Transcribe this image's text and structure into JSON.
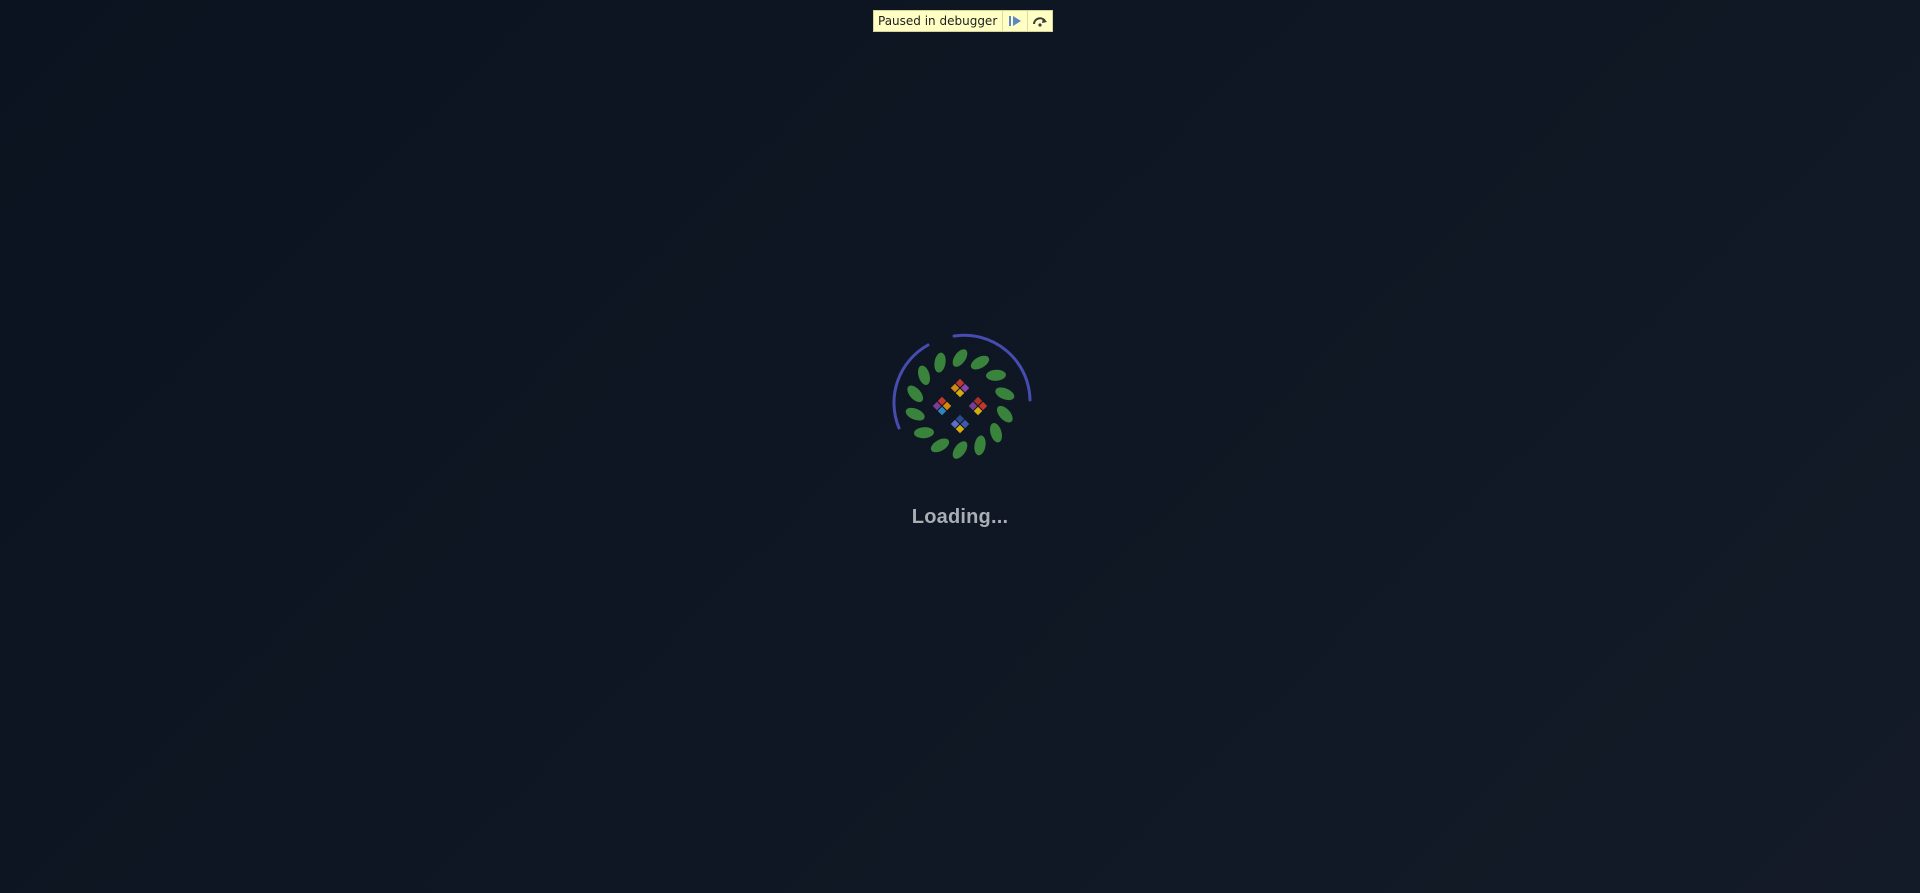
{
  "debugger": {
    "status_text": "Paused in debugger",
    "resume_icon": "resume-icon",
    "step_over_icon": "step-over-icon"
  },
  "loader": {
    "text": "Loading...",
    "logo_icon": "leaf-wreath-logo-icon",
    "ring_color": "#4a4fb8",
    "leaf_color": "#3f8f3f"
  },
  "colors": {
    "background": "#0f1724",
    "banner_bg": "#ffffc3"
  }
}
